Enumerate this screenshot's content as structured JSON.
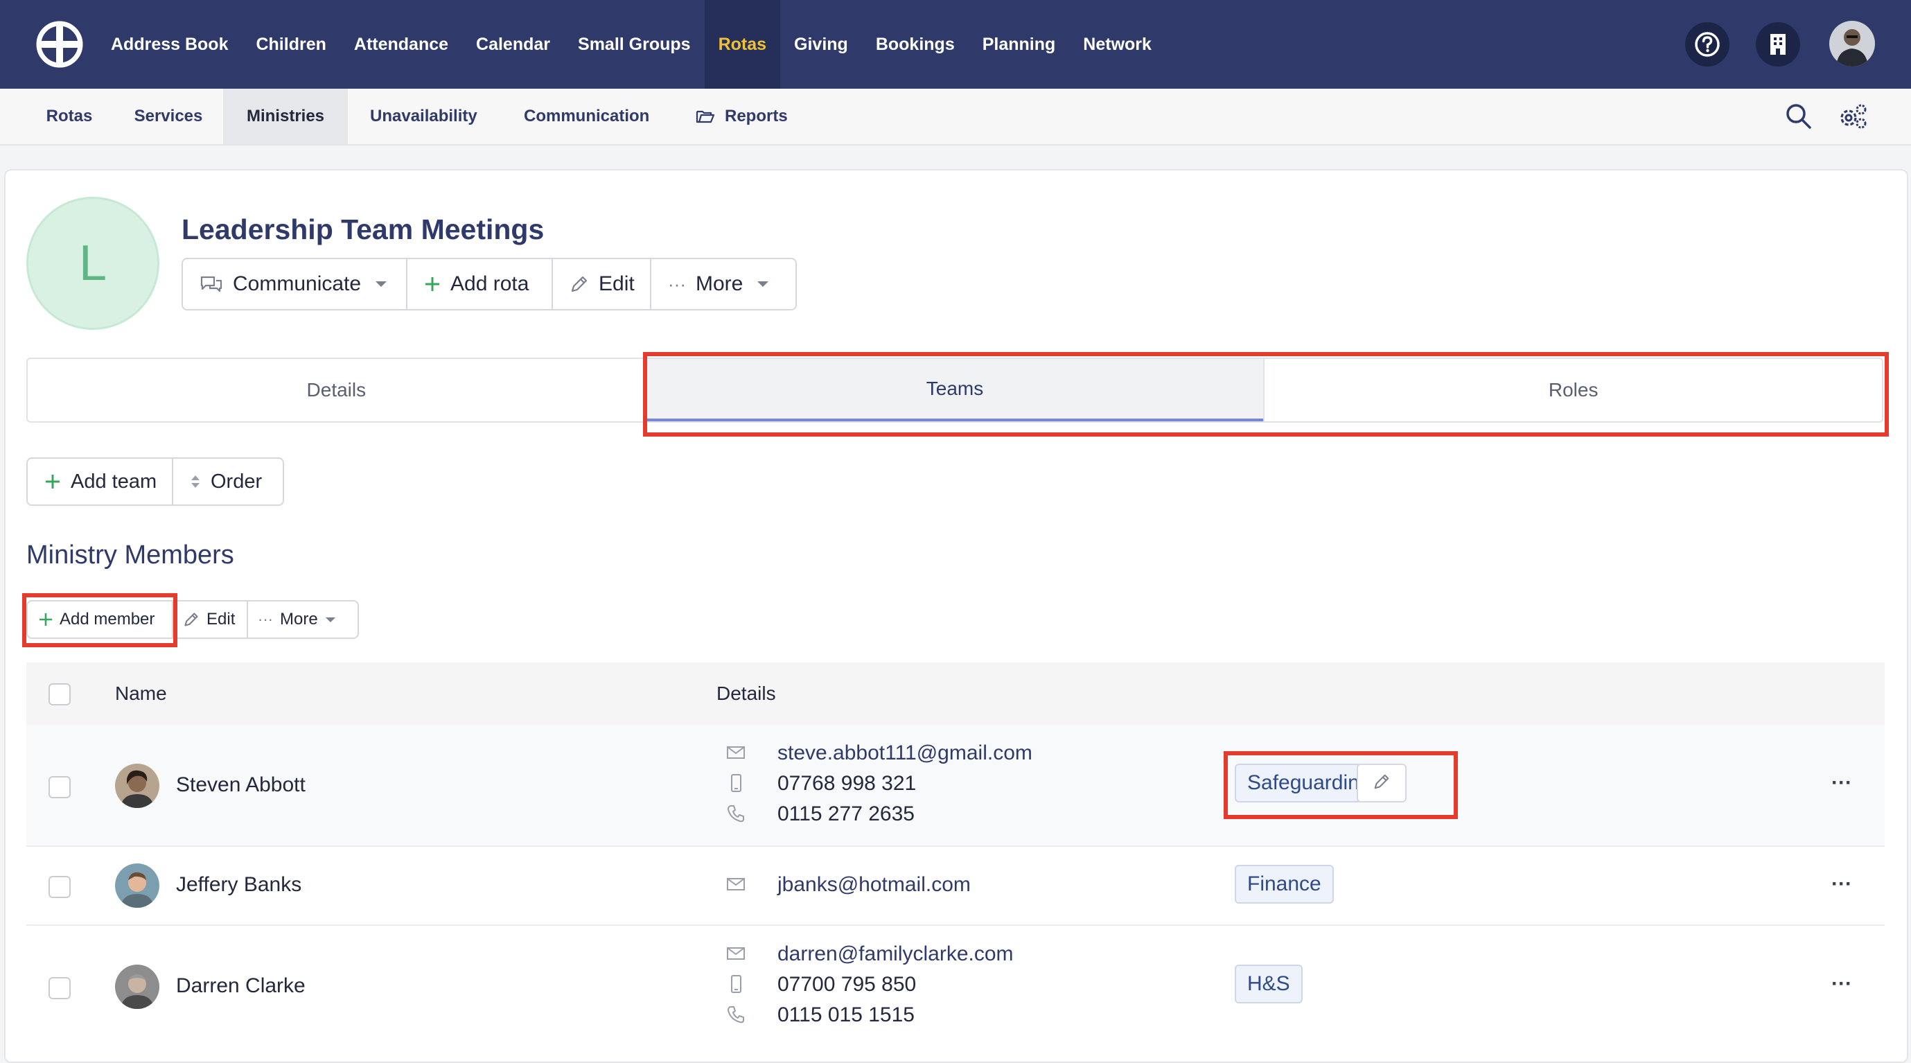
{
  "topnav": {
    "items": [
      "Address Book",
      "Children",
      "Attendance",
      "Calendar",
      "Small Groups",
      "Rotas",
      "Giving",
      "Bookings",
      "Planning",
      "Network"
    ],
    "active": "Rotas"
  },
  "subnav": {
    "items": [
      "Rotas",
      "Services",
      "Ministries",
      "Unavailability",
      "Communication",
      "Reports"
    ],
    "active": "Ministries"
  },
  "ministry": {
    "initial": "L",
    "title": "Leadership Team Meetings",
    "actions": {
      "communicate": "Communicate",
      "add_rota": "Add rota",
      "edit": "Edit",
      "more": "More"
    }
  },
  "tabs": [
    "Details",
    "Teams",
    "Roles"
  ],
  "active_tab": "Teams",
  "teams_toolbar": {
    "add_team": "Add team",
    "order": "Order"
  },
  "members_section": {
    "title": "Ministry Members",
    "add_member": "Add member",
    "edit": "Edit",
    "more": "More"
  },
  "table": {
    "headers": {
      "name": "Name",
      "details": "Details"
    },
    "rows": [
      {
        "name": "Steven Abbott",
        "email": "steve.abbot111@gmail.com",
        "mobile": "07768 998 321",
        "phone": "0115 277 2635",
        "team": "Safeguarding"
      },
      {
        "name": "Jeffery Banks",
        "email": "jbanks@hotmail.com",
        "team": "Finance"
      },
      {
        "name": "Darren Clarke",
        "email": "darren@familyclarke.com",
        "mobile": "07700 795 850",
        "phone": "0115 015 1515",
        "team": "H&S"
      }
    ]
  },
  "colors": {
    "nav_bg": "#2f3a6b",
    "nav_active": "#f0c233",
    "highlight": "#e43b2c",
    "add_green": "#3aa65c"
  }
}
